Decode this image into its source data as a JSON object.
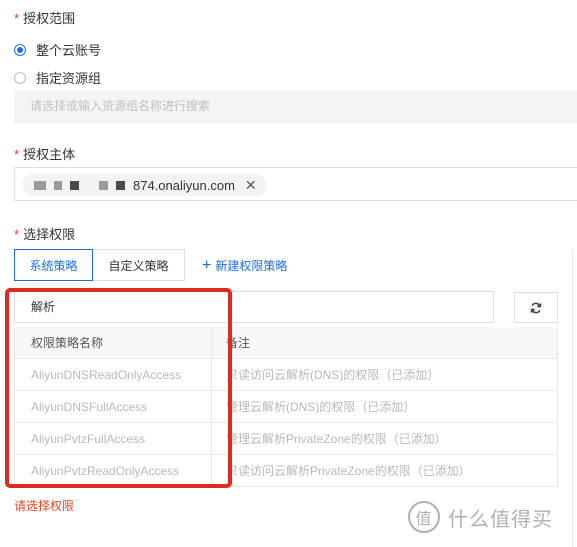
{
  "scope": {
    "label": "授权范围",
    "required_mark": "*",
    "options": [
      {
        "label": "整个云账号",
        "checked": true
      },
      {
        "label": "指定资源组",
        "checked": false
      }
    ],
    "resource_group_placeholder": "请选择或输入资源组名称进行搜索"
  },
  "principal": {
    "label": "授权主体",
    "required_mark": "*",
    "tag_text": "874.onaliyun.com",
    "tag_close_icon": "close-icon"
  },
  "permissions": {
    "label": "选择权限",
    "required_mark": "*",
    "tabs": [
      "系统策略",
      "自定义策略"
    ],
    "active_tab": "系统策略",
    "new_policy_link": "新建权限策略",
    "search_value": "解析",
    "refresh_icon": "refresh-icon",
    "table": {
      "columns": [
        "权限策略名称",
        "备注"
      ],
      "rows": [
        {
          "name": "AliyunDNSReadOnlyAccess",
          "note": "只读访问云解析(DNS)的权限（已添加）"
        },
        {
          "name": "AliyunDNSFullAccess",
          "note": "管理云解析(DNS)的权限（已添加）"
        },
        {
          "name": "AliyunPvtzFullAccess",
          "note": "管理云解析PrivateZone的权限（已添加）"
        },
        {
          "name": "AliyunPvtzReadOnlyAccess",
          "note": "只读访问云解析PrivateZone的权限（已添加）"
        }
      ]
    },
    "error_message": "请选择权限"
  },
  "watermark": {
    "text": "什么值得买",
    "logo_char": "值"
  },
  "colors": {
    "primary": "#1e6fd9",
    "required": "#e0491f",
    "highlight": "#e02a20"
  }
}
